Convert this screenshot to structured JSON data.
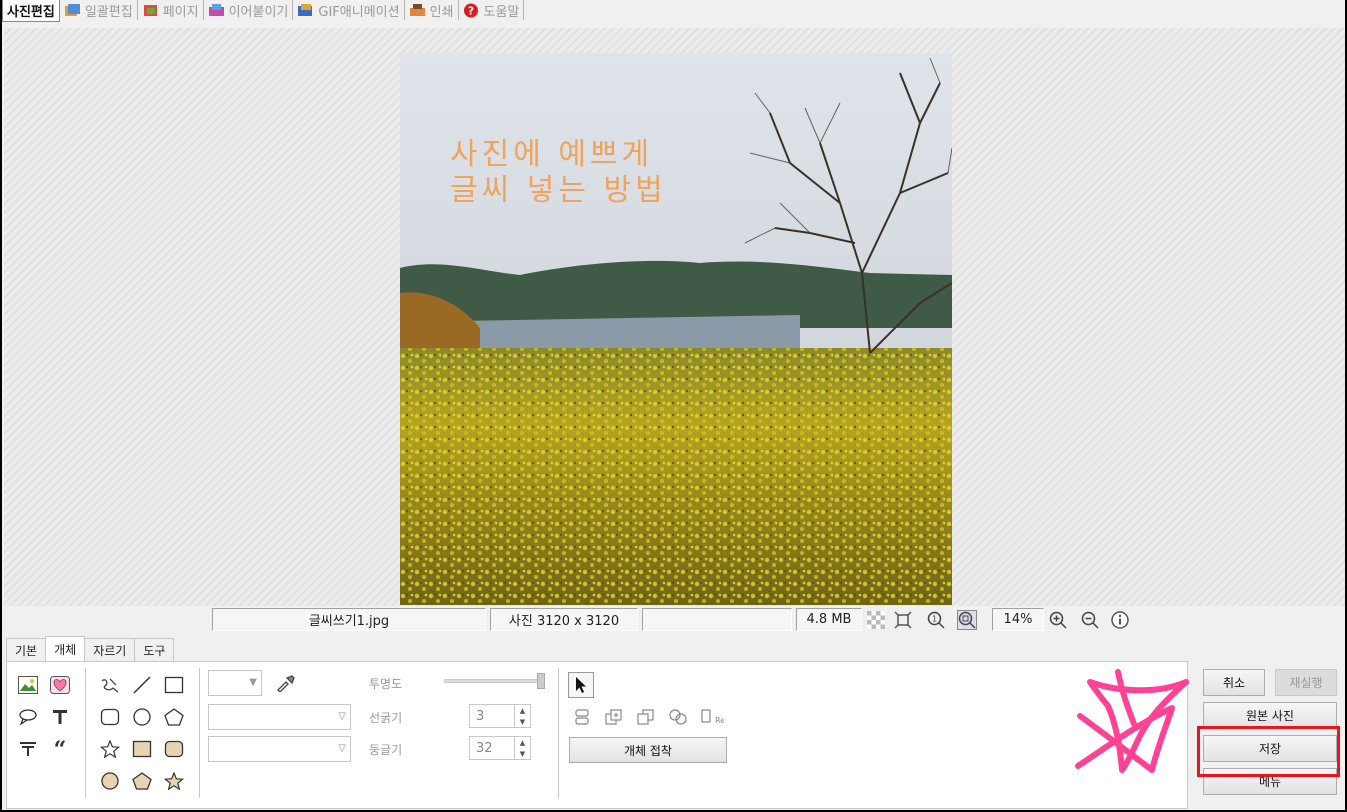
{
  "top_tabs": [
    {
      "label": "사진편집",
      "icon": "none",
      "active": true
    },
    {
      "label": "일괄편집",
      "icon": "batch-icon"
    },
    {
      "label": "페이지",
      "icon": "page-icon"
    },
    {
      "label": "이어붙이기",
      "icon": "merge-icon"
    },
    {
      "label": "GIF애니메이션",
      "icon": "gif-icon"
    },
    {
      "label": "인쇄",
      "icon": "print-icon"
    },
    {
      "label": "도움말",
      "icon": "help-icon"
    }
  ],
  "photo": {
    "overlay_text_line1": "사진에 예쁘게",
    "overlay_text_line2": "글씨 넣는 방법"
  },
  "status": {
    "filename": "글씨쓰기1.jpg",
    "dimensions": "사진 3120 x 3120",
    "extra": "",
    "filesize": "4.8 MB",
    "zoom": "14%"
  },
  "bottom_tabs": [
    {
      "label": "기본"
    },
    {
      "label": "개체",
      "active": true
    },
    {
      "label": "자르기"
    },
    {
      "label": "도구"
    }
  ],
  "object_panel": {
    "opacity_label": "투명도",
    "line_width_label": "선굵기",
    "line_width_value": "3",
    "roundness_label": "둥글기",
    "roundness_value": "32",
    "attach_button": "개체 접착"
  },
  "actions": {
    "cancel": "취소",
    "redo": "재실행",
    "original": "원본 사진",
    "save": "저장",
    "menu": "메뉴"
  },
  "colors": {
    "highlight": "#e8141e",
    "scribble": "#ff2e8a",
    "overlay_text": "#f0a35a"
  }
}
